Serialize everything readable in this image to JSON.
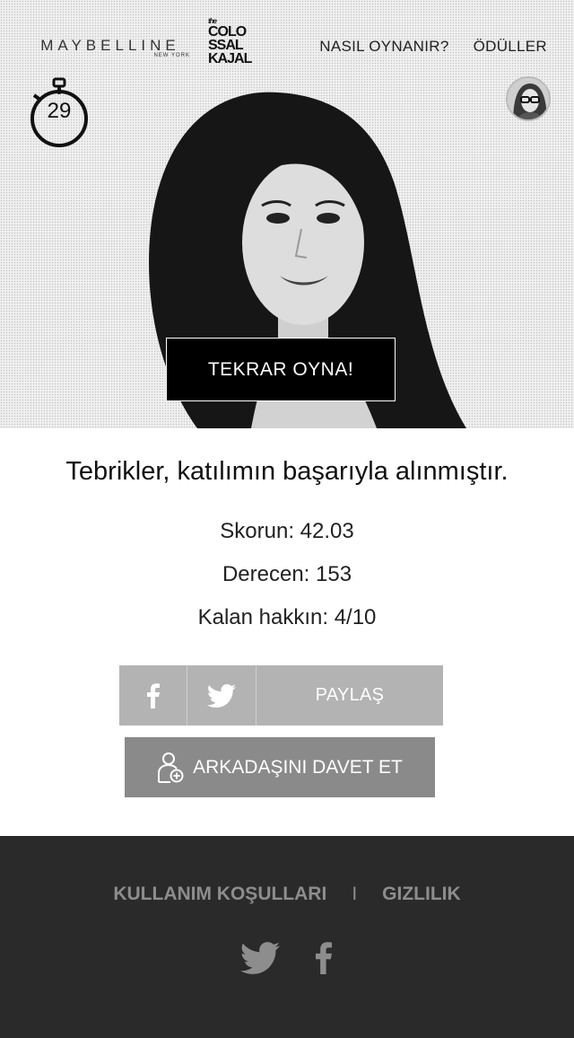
{
  "header": {
    "brand": "MAYBELLINE",
    "brand_sub": "NEW YORK",
    "campaign_logo": {
      "the": "the",
      "lines": [
        "COLO",
        "SSAL",
        "KAJAL"
      ]
    },
    "nav": [
      {
        "label": "NASIL OYNANIR?"
      },
      {
        "label": "ÖDÜLLER"
      }
    ]
  },
  "timer": {
    "value": "29",
    "icon": "stopwatch-icon"
  },
  "avatar": {
    "icon": "user-avatar"
  },
  "hero": {
    "replay_label": "TEKRAR OYNA!"
  },
  "result": {
    "title": "Tebrikler, katılımın başarıyla alınmıştır.",
    "score": "Skorun: 42.03",
    "rank": "Derecen: 153",
    "remaining": "Kalan hakkın: 4/10"
  },
  "share": {
    "label": "PAYLAŞ",
    "icons": [
      "facebook-icon",
      "twitter-icon"
    ]
  },
  "invite": {
    "label": "ARKADAŞINI DAVET ET",
    "icon": "add-user-icon"
  },
  "footer": {
    "links": [
      {
        "label": "KULLANIM KOŞULLARI"
      },
      {
        "label": "GIZLILIK"
      }
    ],
    "separator": "I",
    "social": [
      "twitter-icon",
      "facebook-icon"
    ]
  },
  "colors": {
    "share_bg": "#b3b3b3",
    "invite_bg": "#8a8a8a",
    "footer_bg": "#2a2a2a",
    "footer_text": "#8d8d8d",
    "button_bg": "#000000"
  }
}
